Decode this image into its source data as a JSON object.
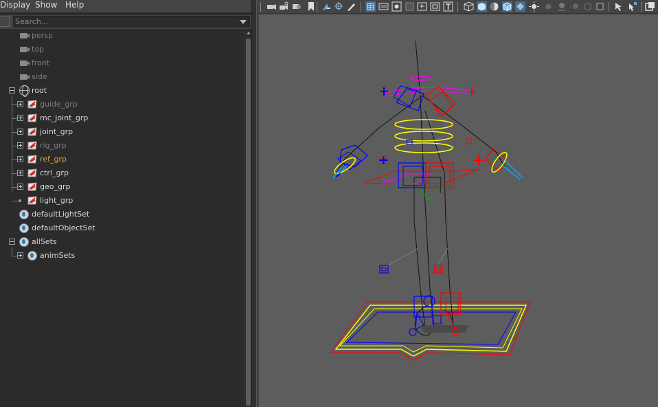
{
  "menubar": {
    "items": [
      "Display",
      "Show",
      "Help"
    ]
  },
  "search": {
    "placeholder": "Search..."
  },
  "outliner": {
    "cameras": [
      {
        "label": "persp",
        "color": "#7d7d7d"
      },
      {
        "label": "top",
        "color": "#7d7d7d"
      },
      {
        "label": "front",
        "color": "#7d7d7d"
      },
      {
        "label": "side",
        "color": "#7d7d7d"
      }
    ],
    "root": {
      "label": "root",
      "color": "#d6d6d6"
    },
    "groups": [
      {
        "label": "guide_grp",
        "color": "#7d7d7d",
        "icon": "group-icon"
      },
      {
        "label": "mc_joint_grp",
        "color": "#d6d6d6",
        "icon": "group-icon"
      },
      {
        "label": "joint_grp",
        "color": "#d6d6d6",
        "icon": "group-icon"
      },
      {
        "label": "rig_grp",
        "color": "#7d7d7d",
        "icon": "group-icon"
      },
      {
        "label": "ref_grp",
        "color": "#e0a23a",
        "icon": "group-icon"
      },
      {
        "label": "ctrl_grp",
        "color": "#d6d6d6",
        "icon": "group-icon"
      },
      {
        "label": "geo_grp",
        "color": "#d6d6d6",
        "icon": "group-icon"
      },
      {
        "label": "light_grp",
        "color": "#d6d6d6",
        "icon": "group-icon"
      }
    ],
    "sets": [
      {
        "label": "defaultLightSet",
        "color": "#d6d6d6"
      },
      {
        "label": "defaultObjectSet",
        "color": "#d6d6d6"
      }
    ],
    "allSets": {
      "label": "allSets",
      "color": "#d6d6d6"
    },
    "animSets": {
      "label": "animSets",
      "color": "#d6d6d6"
    }
  },
  "toolbar": {
    "icons": [
      "select-camera-icon",
      "camera-attributes-icon",
      "bookmark-icon",
      "image-plane-icon",
      "2d-pan-zoom-icon",
      "grease-pencil-icon",
      "grid-icon",
      "film-gate-icon",
      "resolution-gate-icon",
      "gate-mask-icon",
      "field-chart-icon",
      "safe-action-icon",
      "safe-title-icon",
      "wireframe-icon",
      "smooth-shade-icon",
      "default-material-icon",
      "wireframe-on-shaded-icon",
      "xray-icon",
      "use-all-lights-icon",
      "shadows-icon",
      "screen-space-ao-icon",
      "motion-blur-icon",
      "multisample-aa-icon",
      "depth-of-field-icon",
      "isolate-select-icon",
      "xray-joints-icon",
      "panel-layout-icon"
    ]
  },
  "colors": {
    "outliner_bg": "#2b2b2b",
    "viewport_bg": "#5d5d5d",
    "rig_left": "#0000ff",
    "rig_right": "#ff0000",
    "rig_center": "#ffff00",
    "rig_accent": "#ff00ff"
  }
}
